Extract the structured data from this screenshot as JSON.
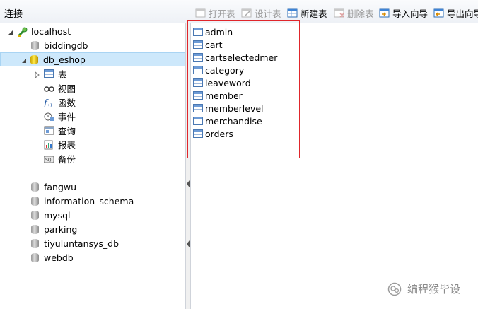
{
  "connection_panel": {
    "title": "连接"
  },
  "toolbar": {
    "buttons": [
      {
        "label": "打开表",
        "icon": "open-table-icon",
        "enabled": false
      },
      {
        "label": "设计表",
        "icon": "design-table-icon",
        "enabled": false
      },
      {
        "label": "新建表",
        "icon": "new-table-icon",
        "enabled": true
      },
      {
        "label": "删除表",
        "icon": "delete-table-icon",
        "enabled": false
      },
      {
        "label": "导入向导",
        "icon": "import-wizard-icon",
        "enabled": true
      },
      {
        "label": "导出向导",
        "icon": "export-wizard-icon",
        "enabled": true
      }
    ]
  },
  "tree": {
    "host": "localhost",
    "databases": [
      "biddingdb",
      "db_eshop",
      "fangwu",
      "information_schema",
      "mysql",
      "parking",
      "tiyuluntansys_db",
      "webdb"
    ],
    "selected_db": "db_eshop",
    "children": [
      {
        "label": "表",
        "icon": "table-icon"
      },
      {
        "label": "视图",
        "icon": "view-icon"
      },
      {
        "label": "函数",
        "icon": "function-icon"
      },
      {
        "label": "事件",
        "icon": "event-icon"
      },
      {
        "label": "查询",
        "icon": "query-icon"
      },
      {
        "label": "报表",
        "icon": "report-icon"
      },
      {
        "label": "备份",
        "icon": "backup-icon"
      }
    ]
  },
  "tables": [
    "admin",
    "cart",
    "cartselectedmer",
    "category",
    "leaveword",
    "member",
    "memberlevel",
    "merchandise",
    "orders"
  ],
  "watermark": {
    "text": "编程猴毕设"
  },
  "colors": {
    "highlight_box": "#e0262b",
    "selected_row": "#cde8fb"
  }
}
